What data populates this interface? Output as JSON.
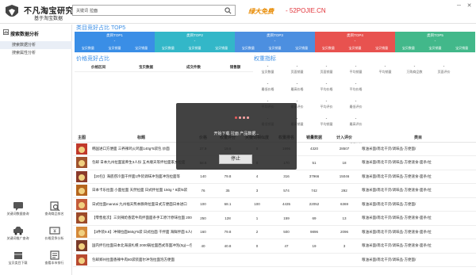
{
  "header": {
    "app_title": "不凡淘宝研究会",
    "app_subtitle": "基于淘宝数据",
    "search_label": "关键词",
    "search_value": "拉面",
    "promo_text": "绿大免费",
    "promo_site": "- 52POJIE.CN",
    "win_minimize": "─",
    "win_close": "✕"
  },
  "sidebar": {
    "section_title": "搜索数据分析",
    "items": [
      {
        "label": "搜索数据分析"
      },
      {
        "label": "搜索属性分析"
      }
    ],
    "tools": [
      {
        "label": "关键词数据查询",
        "icon": "chat-icon"
      },
      {
        "label": "查询商品排名",
        "icon": "search-doc-icon"
      },
      {
        "label": "关键词推广查询",
        "icon": "car-icon"
      },
      {
        "label": "价格竞争分析",
        "icon": "price-icon"
      },
      {
        "label": "宝贝类目下载",
        "icon": "box-icon"
      },
      {
        "label": "查看本市排行",
        "icon": "list-icon"
      }
    ]
  },
  "category_section": {
    "title": "类目竞好占比 TOP5",
    "columns": [
      {
        "head": "类目TOP1",
        "color": "#3a8ee6",
        "value": "-",
        "subs": [
          "宝贝数量",
          "宝贝销量",
          "宝贝销量"
        ]
      },
      {
        "head": "类目TOP2",
        "color": "#33b7c8",
        "value": "-",
        "subs": [
          "宝贝数量",
          "宝贝销量",
          "宝贝销量"
        ]
      },
      {
        "head": "类目TOP3",
        "color": "#4c8fe0",
        "value": "-",
        "subs": [
          "宝贝数量",
          "宝贝销量",
          "宝贝销量"
        ]
      },
      {
        "head": "类目TOP4",
        "color": "#e8524f",
        "value": "-",
        "subs": [
          "宝贝数量",
          "宝贝销量",
          "宝贝销量"
        ]
      },
      {
        "head": "类目TOP5",
        "color": "#42b88a",
        "value": "-",
        "subs": [
          "宝贝数量",
          "宝贝销量",
          "宝贝销量"
        ]
      }
    ]
  },
  "price_section": {
    "title": "价格竞好占比",
    "headers": [
      "价格区间",
      "宝贝数据",
      "成交件数",
      "销售额"
    ]
  },
  "weight_section": {
    "title": "权重指标",
    "cells": [
      {
        "value": "-",
        "label": "宝贝数量"
      },
      {
        "value": "-",
        "label": "页面销量"
      },
      {
        "value": "-",
        "label": "页面销量"
      },
      {
        "value": "-",
        "label": "平均销量"
      },
      {
        "value": "-",
        "label": "平均销量"
      },
      {
        "value": "-",
        "label": "万购商品数"
      },
      {
        "value": "-",
        "label": "页面评价"
      },
      {
        "value": "-",
        "label": "最低价格"
      },
      {
        "value": "-",
        "label": "最高价格"
      },
      {
        "value": "-",
        "label": "平均价格"
      },
      {
        "value": "-",
        "label": "平均价格"
      },
      {
        "value": "-",
        "label": "平均评价"
      },
      {
        "value": "-",
        "label": "最高评价"
      },
      {
        "value": "-",
        "label": "平均评价"
      },
      {
        "value": "-",
        "label": "最低销量"
      },
      {
        "value": "-",
        "label": "最高销量"
      },
      {
        "value": "-",
        "label": "平均销量"
      },
      {
        "value": "-",
        "label": "最低评价"
      },
      {
        "value": "-",
        "label": "最高评价"
      },
      {
        "value": "-",
        "label": "最低评价"
      }
    ]
  },
  "table": {
    "headers": [
      "主图",
      "标题",
      "价格",
      "权重评分",
      "关键词相似度",
      "权重排名",
      "销量数据",
      "计入评价",
      "类目"
    ],
    "rows": [
      {
        "title": "韩国进口方便面 三养辣鸡火鸡面140g*5袋包 炒面",
        "price": "37.9",
        "score": "19.6",
        "sim": "0",
        "rank": "1996",
        "sales": "4320",
        "reviews": "28507",
        "cat": "粮油米面/南北干货/调味品-方便面/"
      },
      {
        "title": "包邮 日本九州拉面宴养生3人份 五木顺天等拌拉面家乡拉面",
        "price": "58.8",
        "score": "9.6",
        "sim": "0",
        "rank": "170",
        "sales": "51",
        "reviews": "18",
        "cat": "粮油米面/南北干货/调味品-方便速食-面条/拉"
      },
      {
        "title": "【20包】海底捞冷面干拌面1件装调味冲泡面冲泡拉面等",
        "price": "140",
        "score": "79.8",
        "sim": "4",
        "rank": "316",
        "sales": "37966",
        "reviews": "15046",
        "cat": "粮油米面/南北干货/调味品-方便速食-面条/拉"
      },
      {
        "title": "日本卡乐拉面 小面拉面 天然拉面 日式拌拉面 150g * 8袋/5袋",
        "price": "76",
        "score": "35",
        "sim": "3",
        "rank": "574",
        "sales": "742",
        "reviews": "292",
        "cat": "粮油米面/南北干货/调味品-方便速食-面条/拉"
      },
      {
        "title": "日式拉面marutai 九州福天熊本豚骨拉面日式方便面日本进口",
        "price": "100",
        "score": "68.1",
        "sim": "100",
        "rank": "4435",
        "sales": "22052",
        "reviews": "6369",
        "cat": "粮油米面/南北干货/调味品-方便面/"
      },
      {
        "title": "【零售批次】三剑辣炝香菇牛肉拌面面条手工原汁原味拉面 200g*10",
        "price": "250",
        "score": "128",
        "sim": "1",
        "rank": "159",
        "sales": "69",
        "reviews": "13",
        "cat": "粮油米面/南北干货/调味品-方便速食-面条/拉"
      },
      {
        "title": "【3件装9.8】冲辣拉面560g*5袋 日式拉面 干拌面 海鲜拌面 6人份",
        "price": "160",
        "score": "79.8",
        "sim": "2",
        "rank": "500",
        "sales": "9896",
        "reviews": "2096",
        "cat": "粮油米面/南北干货/调味品-方便速食-面条/拉"
      },
      {
        "title": "国内拌包拉面日本北海道札幌 2000锅拉面西式等面冲泡(0g)一包",
        "price": "40",
        "score": "40.8",
        "sim": "0",
        "rank": "47",
        "sales": "19",
        "reviews": "3",
        "cat": "粮油米面/南北干货/调味品-方便速食-面条/拉"
      },
      {
        "title": "包邮郑州拉面香辣牛肉80袋装面尔冲泡拉面泡方便面",
        "price": "",
        "score": "",
        "sim": "",
        "rank": "",
        "sales": "",
        "reviews": "",
        "cat": "粮油米面/南北干货/调味品-方便面/"
      }
    ]
  },
  "overlay": {
    "message": "开始下载 拉面 产品数据...",
    "button_label": "停止",
    "dot_colors": [
      "#e05a5a",
      "#f0a0a0",
      "#f0a0a0",
      "#f0a0a0"
    ]
  }
}
